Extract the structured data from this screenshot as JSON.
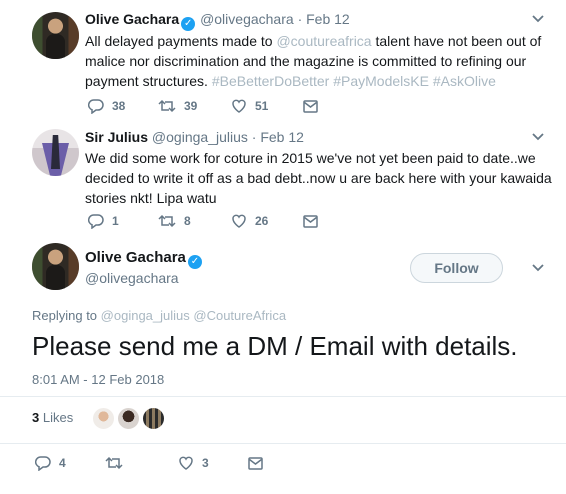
{
  "tweet1": {
    "name": "Olive Gachara",
    "handle": "@olivegachara",
    "dot": "·",
    "date": "Feb 12",
    "text_before": "All delayed payments made to ",
    "mention": "@coutureafrica",
    "text_after": " talent have not been out of malice nor discrimination and the magazine is committed to refining our payment structures. ",
    "hashtags": "#BeBetterDoBetter #PayModelsKE #AskOlive",
    "replies": "38",
    "retweets": "39",
    "likes": "51"
  },
  "tweet2": {
    "name": "Sir Julius",
    "handle": "@oginga_julius",
    "dot": "·",
    "date": "Feb 12",
    "text": "We did some work for coture in 2015 we've not yet been paid to date..we decided to write it off as a bad debt..now u are back here with your kawaida stories nkt! Lipa watu",
    "replies": "1",
    "retweets": "8",
    "likes": "26"
  },
  "main": {
    "name": "Olive Gachara",
    "handle": "@olivegachara",
    "follow_label": "Follow",
    "replying_prefix": "Replying to",
    "replying_to": "@oginga_julius @CoutureAfrica",
    "text": "Please send me a DM / Email with details.",
    "timestamp": "8:01 AM - 12 Feb 2018",
    "likes_count": "3",
    "likes_label": "Likes",
    "replies": "4",
    "likes": "3"
  },
  "colors": {
    "accent": "#1da1f2",
    "muted": "#657786",
    "hashtag": "#aab8c2"
  },
  "icons": [
    "chevron-down-icon",
    "reply-icon",
    "retweet-icon",
    "like-icon",
    "dm-icon",
    "verified-icon"
  ]
}
